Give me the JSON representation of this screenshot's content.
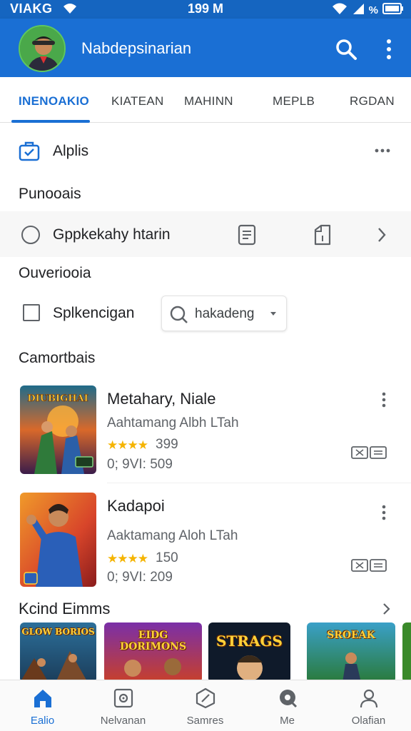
{
  "status_bar": {
    "carrier": "VIAKG",
    "time": "199 M",
    "battery": "%"
  },
  "app_bar": {
    "title": "Nabdepsinarian",
    "avatar": "avatar"
  },
  "tabs": [
    {
      "label": "INENOAKIO",
      "active": true
    },
    {
      "label": "KIATEAN",
      "active": false
    },
    {
      "label": "MAHINN",
      "active": false
    },
    {
      "label": "MEPLB",
      "active": false
    },
    {
      "label": "RGDAN",
      "active": false
    }
  ],
  "apps_row": {
    "label": "Alplis",
    "icon": "briefcase-icon"
  },
  "sections": {
    "first": "Punooais",
    "second": "Ouveriooia",
    "third": "Camortbais"
  },
  "radio_row": {
    "label": "Gppkekahy htarin"
  },
  "check_row": {
    "label": "Splkencigan"
  },
  "dropdown": {
    "label": "hakadeng"
  },
  "games": [
    {
      "title": "Metahary, Niale",
      "developer": "Aahtamang Albh LTah",
      "stars": "★★★★",
      "rating": "399",
      "meta": "0; 9VI: 509",
      "thumb_text": "DIUBIGHAI"
    },
    {
      "title": "Kadapoi",
      "developer": "Aaktamang Aloh LTah",
      "stars": "★★★★",
      "rating": "150",
      "meta": "0; 9VI: 209",
      "thumb_text": ""
    }
  ],
  "kind_games": {
    "title": "Kcind Eimms",
    "cards": [
      "GLOW BORIOS",
      "EIDG DORIMONS",
      "STRAGS",
      "SROEAK"
    ]
  },
  "bottom_nav": [
    {
      "label": "Ealio",
      "icon": "home-icon",
      "active": true
    },
    {
      "label": "Nelvanan",
      "icon": "games-icon",
      "active": false
    },
    {
      "label": "Samres",
      "icon": "cube-icon",
      "active": false
    },
    {
      "label": "Me",
      "icon": "search-bubble-icon",
      "active": false
    },
    {
      "label": "Olafian",
      "icon": "person-icon",
      "active": false
    }
  ],
  "colors": {
    "primary": "#1a6fd4",
    "status": "#1565c0",
    "stars": "#f5b400"
  }
}
